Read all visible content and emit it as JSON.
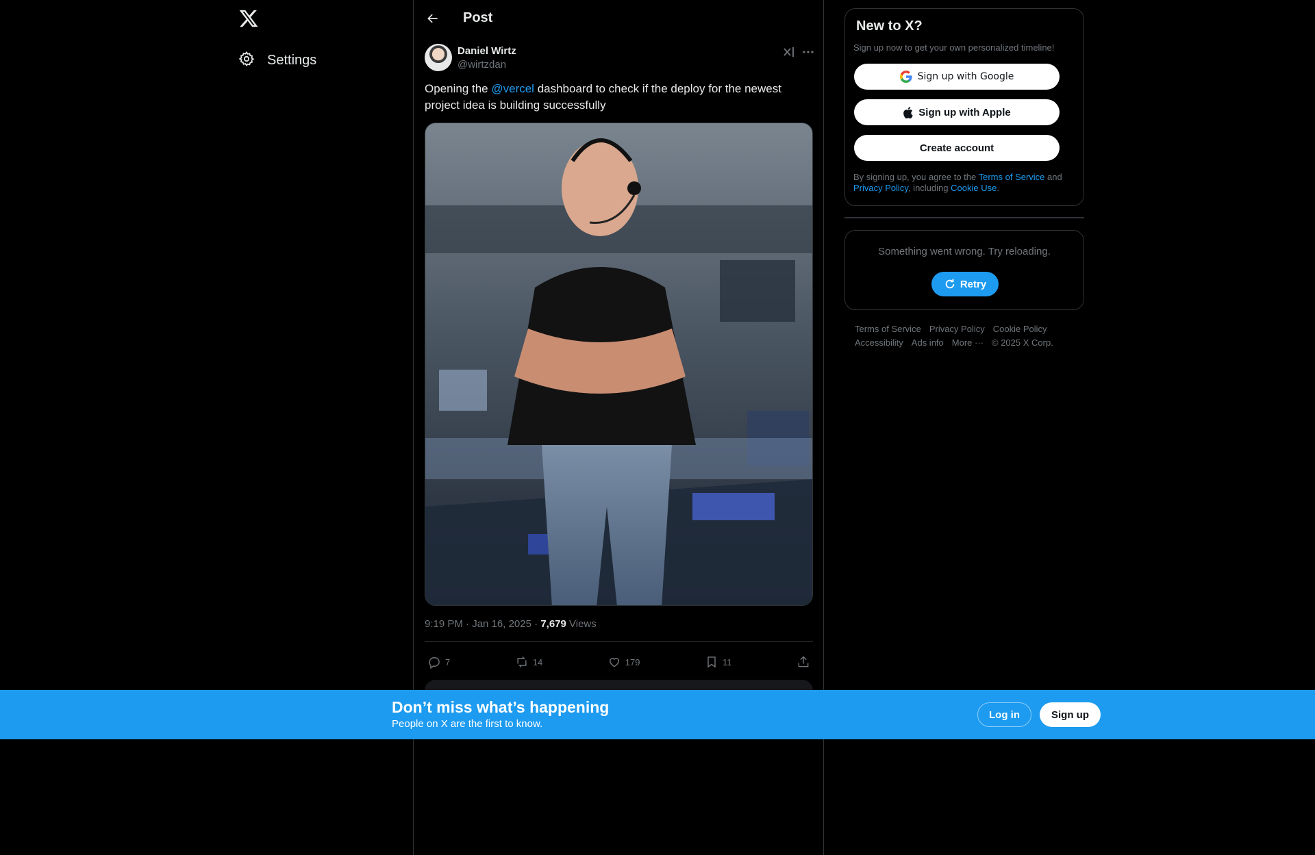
{
  "nav": {
    "settings_label": "Settings"
  },
  "header": {
    "title": "Post"
  },
  "post": {
    "author_name": "Daniel Wirtz",
    "author_handle": "@wirtzdan",
    "text_before": "Opening the ",
    "mention": "@vercel",
    "text_after": " dashboard to check if the deploy for the newest project idea is building successfully",
    "time": "9:19 PM",
    "sep1": " · ",
    "date": "Jan 16, 2025",
    "sep2": " · ",
    "views_count": "7,679",
    "views_label": " Views",
    "replies": "7",
    "reposts": "14",
    "likes": "179",
    "bookmarks": "11"
  },
  "signup_card": {
    "title": "New to X?",
    "subtitle": "Sign up now to get your own personalized timeline!",
    "google_label": "Sign up with Google",
    "apple_label": "Sign up with Apple",
    "create_label": "Create account",
    "legal_prefix": "By signing up, you agree to the ",
    "terms_link": "Terms of Service",
    "legal_and": " and ",
    "privacy_link": "Privacy Policy",
    "legal_including": ", including ",
    "cookie_link": "Cookie Use",
    "legal_end": "."
  },
  "error_card": {
    "message": "Something went wrong. Try reloading.",
    "retry_label": "Retry"
  },
  "footer": {
    "terms": "Terms of Service",
    "privacy": "Privacy Policy",
    "cookie": "Cookie Policy",
    "accessibility": "Accessibility",
    "ads": "Ads info",
    "more": "More ···",
    "copyright": "© 2025 X Corp."
  },
  "banner": {
    "title": "Don’t miss what’s happening",
    "subtitle": "People on X are the first to know.",
    "login_label": "Log in",
    "signup_label": "Sign up"
  },
  "colors": {
    "accent": "#1d9bf0",
    "background": "#000000",
    "border": "#2f3336",
    "muted_text": "#71767b"
  }
}
